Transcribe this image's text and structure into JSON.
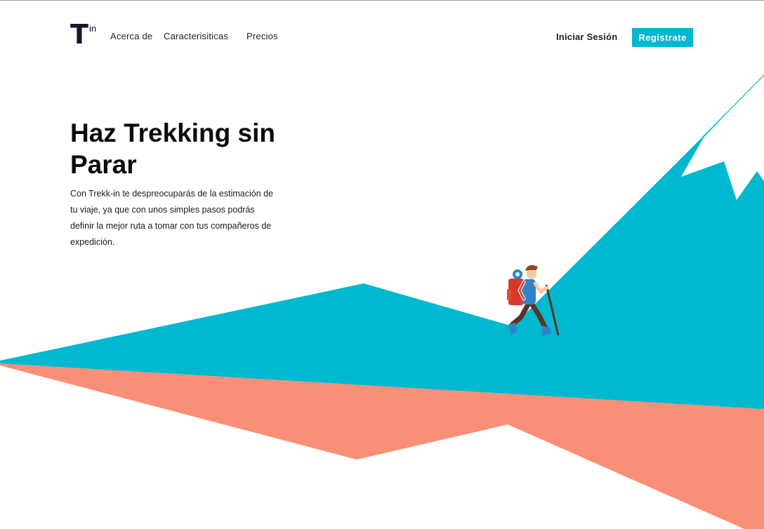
{
  "logo": {
    "letter": "T",
    "superscript": "in"
  },
  "nav": {
    "items": [
      {
        "label": "Acerca de"
      },
      {
        "label": "Caracterisiticas"
      },
      {
        "label": "Precios"
      }
    ],
    "login_label": "Iniciar Sesión",
    "register_label": "Regístrate"
  },
  "hero": {
    "title": "Haz Trekking sin Parar",
    "description": "Con Trekk-in te despreocuparás de la estimación de tu viaje, ya que con unos simples pasos podrás definir la mejor ruta a tomar con tus compañeros de expedición."
  },
  "colors": {
    "accent": "#00b7cf",
    "mountain": "#00b8cf",
    "shadow": "#f98f77",
    "logo": "#0f1b2d"
  },
  "illustration": {
    "subject": "hiker-with-backpack-and-walking-stick"
  }
}
